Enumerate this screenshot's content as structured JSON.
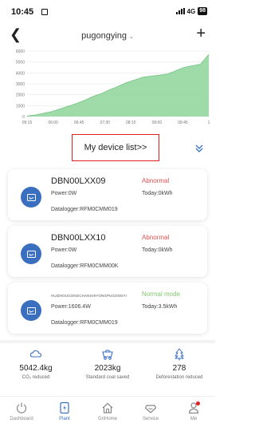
{
  "status_bar": {
    "time": "10:45",
    "network": "4G",
    "battery": "98"
  },
  "nav": {
    "title": "pugongying",
    "title_chevron": "⌄"
  },
  "chart_data": {
    "type": "area",
    "x_ticks": [
      "05:15",
      "06:00",
      "06:45",
      "07:30",
      "08:15",
      "09:00",
      "09:45",
      "1"
    ],
    "y_ticks": [
      "6000",
      "5000",
      "4000",
      "3000",
      "2000",
      "1000",
      "0"
    ],
    "ylim": [
      0,
      6000
    ],
    "fill_color": "#8ed49a",
    "line_color": "#74c484",
    "x": [
      "05:15",
      "05:30",
      "05:45",
      "06:00",
      "06:15",
      "06:30",
      "06:45",
      "07:00",
      "07:15",
      "07:30",
      "07:45",
      "08:00",
      "08:15",
      "08:30",
      "08:45",
      "09:00",
      "09:15",
      "09:30",
      "09:45",
      "10:00",
      "10:15",
      "10:30",
      "10:40"
    ],
    "values": [
      50,
      150,
      300,
      450,
      700,
      950,
      1200,
      1500,
      1850,
      2100,
      2450,
      2750,
      3100,
      3350,
      3600,
      3700,
      3800,
      3900,
      4200,
      4500,
      4650,
      4800,
      5700
    ]
  },
  "device_list": {
    "label": "My device list>>"
  },
  "devices": [
    {
      "name": "DBN00LXX09",
      "status": "Abnormal",
      "status_type": "abnormal",
      "power": "Power:0W",
      "today": "Today:0kWh",
      "datalogger": "Datalogger:RFM0CMM019"
    },
    {
      "name": "DBN00LXX10",
      "status": "Abnormal",
      "status_type": "abnormal",
      "power": "Power:0W",
      "today": "Today:0kWh",
      "datalogger": "Datalogger:RFM0CMM00K"
    },
    {
      "name": "HUIZHOUGONGCHANSHIYONGPUGONGYI",
      "status": "Normal mode",
      "status_type": "normal",
      "power": "Power:1606.4W",
      "today": "Today:3.5kWh",
      "datalogger": "Datalogger:RFM0CMM019"
    }
  ],
  "stats": [
    {
      "value": "5042.4kg",
      "label": "CO₂ reduced",
      "icon": "co2-icon"
    },
    {
      "value": "2023kg",
      "label": "Standard coal saved",
      "icon": "coal-cart-icon"
    },
    {
      "value": "278",
      "label": "Deforestation reduced",
      "icon": "tree-icon"
    }
  ],
  "tabs": [
    {
      "label": "Dashboard",
      "icon": "power-icon"
    },
    {
      "label": "Plant",
      "icon": "plant-icon",
      "active": true
    },
    {
      "label": "GriHome",
      "icon": "home-icon"
    },
    {
      "label": "Service",
      "icon": "service-icon"
    },
    {
      "label": "Me",
      "icon": "person-icon"
    }
  ],
  "colors": {
    "accent": "#3a6fc0",
    "abnormal": "#e05050",
    "normal": "#7fc76a",
    "highlight_border": "#e02020"
  }
}
